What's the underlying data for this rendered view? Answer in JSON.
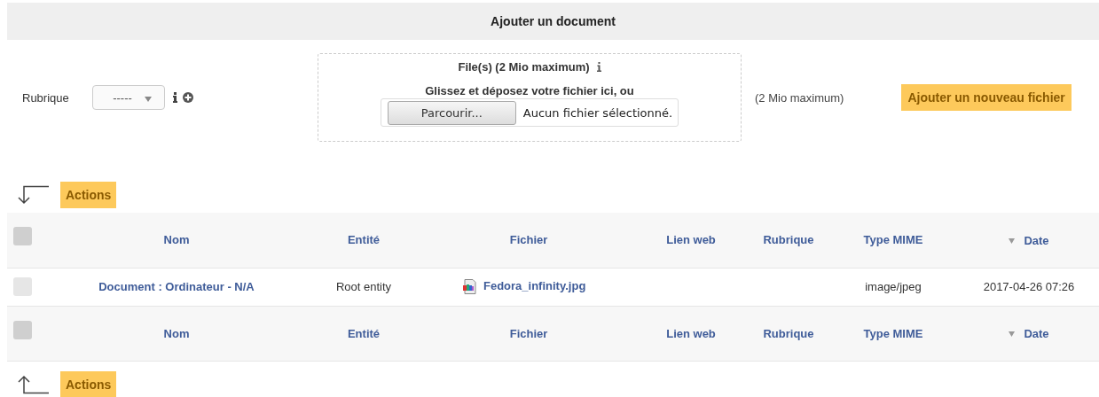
{
  "title": "Ajouter un document",
  "form": {
    "label": "Rubrique",
    "select_value": "-----",
    "dropzone_title": "File(s) (2 Mio maximum)",
    "dropzone_hint": "Glissez et déposez votre fichier ici, ou",
    "browse_button": "Parcourir...",
    "no_file": "Aucun fichier sélectionné.",
    "size_note": "(2 Mio maximum)",
    "add_button": "Ajouter un nouveau fichier"
  },
  "actions_top": "Actions",
  "columns": [
    {
      "label": "Nom",
      "sorted": false
    },
    {
      "label": "Entité",
      "sorted": false
    },
    {
      "label": "Fichier",
      "sorted": false
    },
    {
      "label": "Lien web",
      "sorted": false
    },
    {
      "label": "Rubrique",
      "sorted": false
    },
    {
      "label": "Type MIME",
      "sorted": false
    },
    {
      "label": "Date",
      "sorted": true
    }
  ],
  "header_checked": false,
  "rows": [
    {
      "checked": false,
      "name": "Document : Ordinateur - N/A",
      "entity": "Root entity",
      "file": "Fedora_infinity.jpg",
      "mime": "image/jpeg",
      "date": "2017-04-26 07:26"
    }
  ],
  "footer_checked": false,
  "footer_columns": [
    {
      "label": "Nom",
      "sorted": false
    },
    {
      "label": "Entité",
      "sorted": false
    },
    {
      "label": "Fichier",
      "sorted": false
    },
    {
      "label": "Lien web",
      "sorted": false
    },
    {
      "label": "Rubrique",
      "sorted": false
    },
    {
      "label": "Type MIME",
      "sorted": false
    },
    {
      "label": "Date",
      "sorted": true
    }
  ],
  "actions_bottom": "Actions"
}
